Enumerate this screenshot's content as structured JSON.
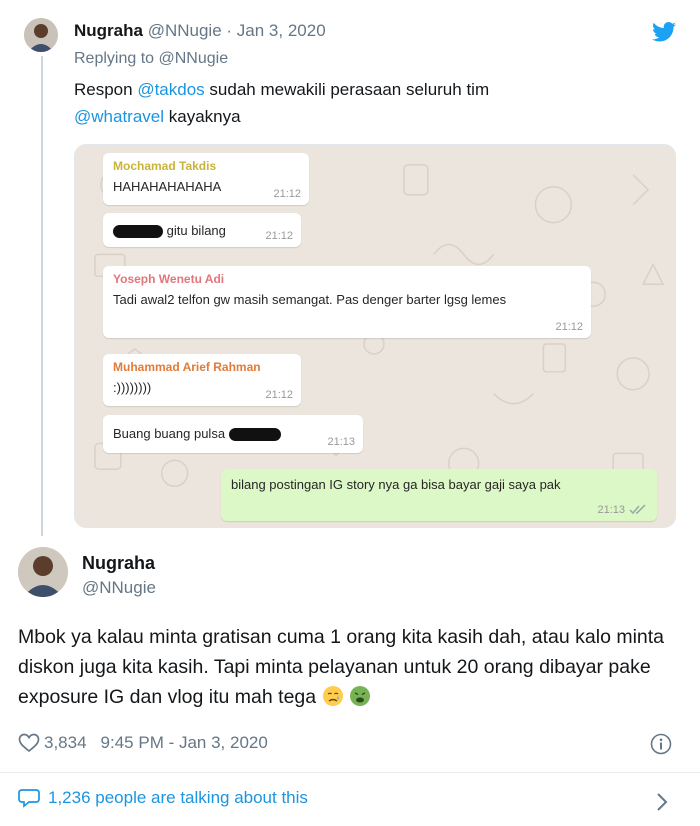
{
  "reply_tweet": {
    "author_name": "Nugraha",
    "author_handle": "@NNugie",
    "separator": "·",
    "date": "Jan 3, 2020",
    "replying_prefix": "Replying to ",
    "replying_to": "@NNugie",
    "text_parts": {
      "p1": "Respon ",
      "mention1": "@takdos",
      "p2": " sudah mewakili perasaan seluruh tim ",
      "mention2": "@whatravel",
      "p3": " kayaknya"
    }
  },
  "chat": {
    "messages": [
      {
        "sender": "Mochamad Takdis",
        "sender_color": "#c9b43a",
        "text": "HAHAHAHAHAHA",
        "time": "21:12"
      },
      {
        "sender": "",
        "text": "gitu bilang",
        "time": "21:12",
        "redacted": true
      },
      {
        "sender": "Yoseph Wenetu Adi",
        "sender_color": "#e2767b",
        "text": "Tadi awal2 telfon gw masih semangat. Pas denger barter lgsg lemes",
        "time": "21:12"
      },
      {
        "sender": "Muhammad Arief Rahman",
        "sender_color": "#e07b39",
        "text": ":))))))))",
        "time": "21:12"
      },
      {
        "sender": "",
        "text": "Buang buang pulsa",
        "time": "21:13",
        "redacted": true
      },
      {
        "sender": "",
        "text": "bilang postingan IG story nya ga bisa bayar gaji saya pak",
        "time": "21:13",
        "outgoing": true
      }
    ]
  },
  "main_tweet": {
    "author_name": "Nugraha",
    "author_handle": "@NNugie",
    "text": "Mbok ya kalau minta gratisan cuma 1 orang kita kasih dah, atau kalo minta diskon juga kita kasih. Tapi minta pelayanan untuk 20 orang dibayar pake exposure IG dan vlog itu mah tega",
    "likes": "3,834",
    "timestamp": "9:45 PM - Jan 3, 2020",
    "talking": "1,236 people are talking about this"
  },
  "colors": {
    "link": "#1b95e0",
    "secondary_text": "#657786",
    "chat_bg": "#ece5dd",
    "outgoing_bubble": "#dcf8c6"
  },
  "icons": [
    "twitter-bird-icon",
    "heart-icon",
    "info-icon",
    "comment-icon",
    "chevron-right-icon",
    "double-check-icon",
    "disappointed-face-emoji",
    "nauseated-face-emoji"
  ]
}
